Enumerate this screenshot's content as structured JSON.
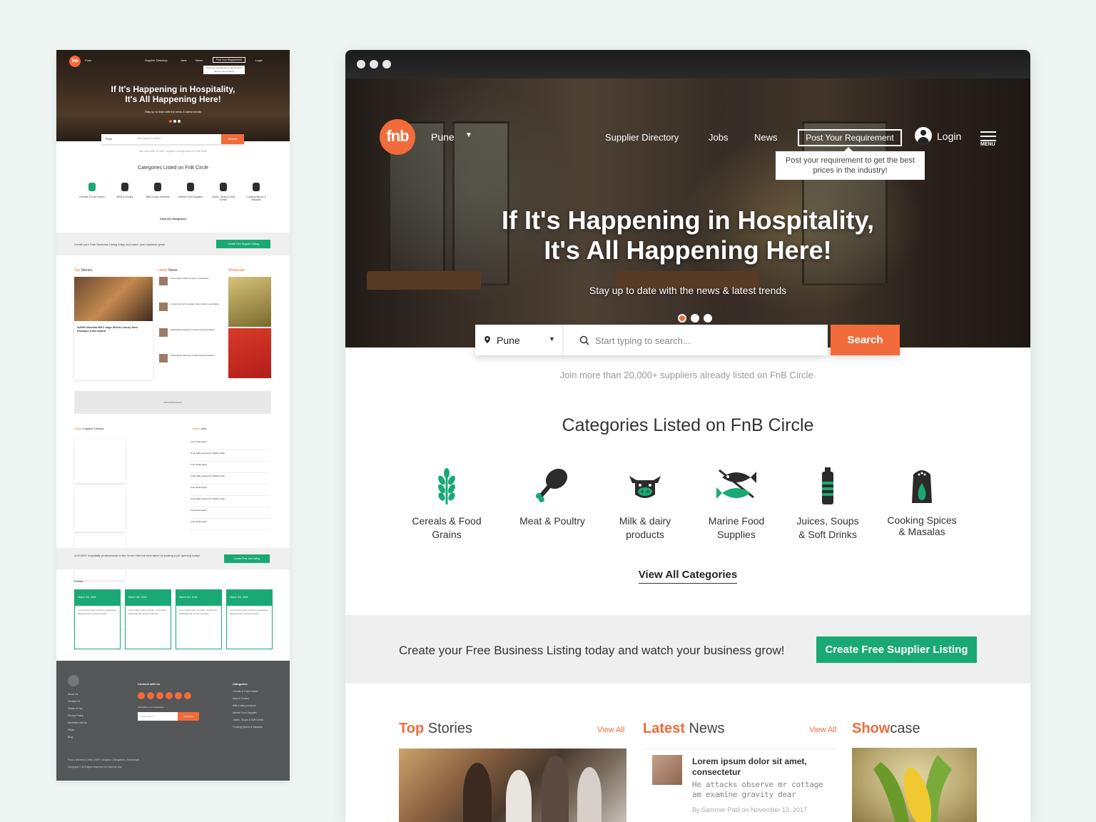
{
  "mini": {
    "nav": [
      "Pune",
      "Supplier Directory",
      "Jobs",
      "News",
      "Post Your Requirement",
      "Login"
    ],
    "tooltip": "Post your requirement to get the best prices in the industry!",
    "title_line1": "If It's Happening in Hospitality,",
    "title_line2": "It's All Happening Here!",
    "subtitle": "Stay up to date with the news & latest trends",
    "search_city": "Pune",
    "search_placeholder": "Start typing to search...",
    "search_button": "Search",
    "join_text": "Join more than 20,000+ suppliers already listed on FnB Circle.",
    "categories_heading": "Categories Listed on FnB Circle",
    "categories": [
      "Cereals & Food Grains",
      "Meat & Poultry",
      "Milk & dairy products",
      "Marine Food Supplies",
      "Juices, Soups & Soft Drinks",
      "Cooking Spices & Masalas"
    ],
    "view_all": "View All Categories",
    "band_text": "Create your Free Business Listing today and watch your business grow!",
    "band_button": "Create Free Supplier Listing",
    "col_top_stories": [
      "Top",
      "Stories"
    ],
    "col_latest_news": [
      "Latest",
      "News"
    ],
    "col_showcase": "Showcase",
    "story_caption": "Sofitel Mumbai BKC bags World Luxury best boutique hotel award",
    "news_items": [
      "Lorem ipsum dolor sit amet, consectetur",
      "Ut enim ad minim veniam, quis nostrud exercitation",
      "Fascinating Features of Café Ceiling Solutions",
      "Fascinating Features of Café Ceiling Solutions"
    ],
    "ad_text": "advertisement",
    "latest_supplier": [
      "Latest",
      "Supplier Listings"
    ],
    "latest_jobs": [
      "Latest",
      "Jobs"
    ],
    "jobs": [
      "Front Desk Agent",
      "Cook Staff required for Waffle Outlet",
      "Front Desk Agent",
      "Cook Staff required for Waffle Outlet",
      "Front Desk Agent",
      "Cook Staff required for Waffle Outlet",
      "Front Desk Agent",
      "Front Desk Agent"
    ],
    "band2_text": "4,00,000+ hospitality professionals in the Circle! Hire the best talent by posting a job opening today!",
    "band2_button": "Create Free Job Listing",
    "events_heading": "Events",
    "event_date": "March 3rd, 2018",
    "event_text": "Lorem ipsum dolor sit amet, consectetur adipiscing elit, sed do eiusmod.",
    "footer_links": [
      "About Us",
      "Contact Us",
      "Terms of Use",
      "Privacy Policy",
      "Advertise with Us",
      "FAQs",
      "Blog"
    ],
    "footer_connect": "Connect with Us",
    "footer_newsletter": "Subscribe to our Newsletter",
    "footer_email_placeholder": "Email Address",
    "footer_subscribe": "Subscribe",
    "footer_categories_heading": "Categories",
    "footer_categories": [
      "Cereals & Food Grains",
      "Meat & Poultry",
      "Milk & dairy products",
      "Marine Food Supplies",
      "Juices, Soups & Soft Drinks",
      "Cooking Spices & Masalas"
    ],
    "footer_cities": "Pune | Mumbai | Delhi | NCR | Gurgaon | Bangalore | Hyderabad",
    "footer_copyright": "Copyright © All Rights Reserved by fnbcircle.com"
  },
  "header": {
    "logo_text": "fnb",
    "city": "Pune",
    "nav": {
      "supplier_directory": "Supplier Directory",
      "jobs": "Jobs",
      "news": "News"
    },
    "post_requirement": "Post Your Requirement",
    "tooltip": "Post your requirement to get the best prices in the industry!",
    "login": "Login",
    "menu_label": "MENU"
  },
  "hero": {
    "title_line1": "If It's Happening in Hospitality,",
    "title_line2": "It's All Happening Here!",
    "subtitle": "Stay up to date with the news & latest trends",
    "slides": 3,
    "active_slide": 1
  },
  "search": {
    "city": "Pune",
    "placeholder": "Start typing to search...",
    "button": "Search"
  },
  "join_text": "Join more than 20,000+ suppliers already listed on FnB Circle.",
  "categories": {
    "heading": "Categories Listed on FnB Circle",
    "items": [
      {
        "line1": "Cereals & Food",
        "line2": "Grains",
        "icon": "wheat-icon"
      },
      {
        "line1": "Meat & Poultry",
        "line2": "",
        "icon": "drumstick-icon"
      },
      {
        "line1": "Milk & dairy",
        "line2": "products",
        "icon": "cow-icon"
      },
      {
        "line1": "Marine Food",
        "line2": "Supplies",
        "icon": "fish-icon"
      },
      {
        "line1": "Juices, Soups",
        "line2": "& Soft Drinks",
        "icon": "bottle-icon"
      },
      {
        "line1": "Cooking Spices",
        "line2": "& Masalas",
        "icon": "spice-jar-icon"
      }
    ],
    "view_all": "View All Categories"
  },
  "cta": {
    "text": "Create your Free Business Listing today and watch your business grow!",
    "button": "Create Free Supplier Listing"
  },
  "sections": {
    "top_stories": {
      "accent": "Top",
      "rest": "Stories",
      "view_all": "View All"
    },
    "latest_news": {
      "accent": "Latest",
      "rest": "News",
      "view_all": "View All"
    },
    "showcase": {
      "accent": "Show",
      "rest": "case"
    }
  },
  "news_item": {
    "title": "Lorem ipsum dolor sit amet, consectetur",
    "desc": "He attacks observe mr cottage am examine gravity dear",
    "meta": "By Sammer Patil on November 13, 2017"
  },
  "colors": {
    "brand_orange": "#f26b3a",
    "brand_green": "#1aa974",
    "page_bg": "#eef5f2"
  }
}
